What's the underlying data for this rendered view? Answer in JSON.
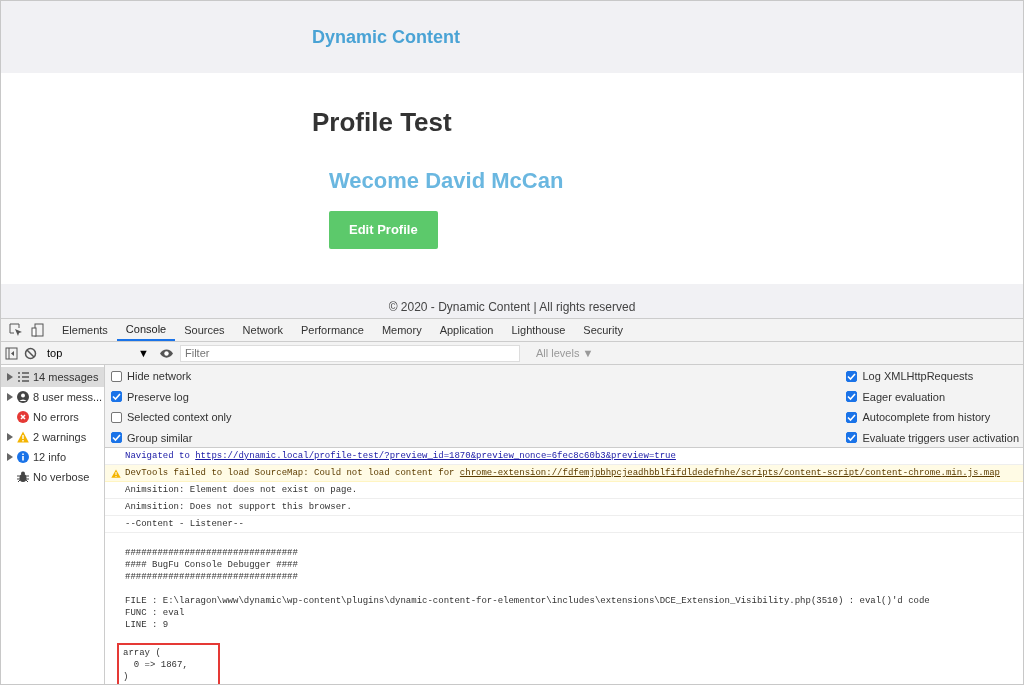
{
  "site": {
    "brand": "Dynamic Content",
    "page_title": "Profile Test",
    "greeting": "Wecome David McCan",
    "edit_button": "Edit Profile",
    "footer": "© 2020 - Dynamic Content | All rights reserved"
  },
  "devtools": {
    "tabs": [
      {
        "label": "Elements",
        "selected": false
      },
      {
        "label": "Console",
        "selected": true
      },
      {
        "label": "Sources",
        "selected": false
      },
      {
        "label": "Network",
        "selected": false
      },
      {
        "label": "Performance",
        "selected": false
      },
      {
        "label": "Memory",
        "selected": false
      },
      {
        "label": "Application",
        "selected": false
      },
      {
        "label": "Lighthouse",
        "selected": false
      },
      {
        "label": "Security",
        "selected": false
      }
    ],
    "toolbar": {
      "context": "top",
      "context_caret": "▼",
      "filter_placeholder": "Filter",
      "levels": "All levels ▼"
    },
    "sidebar": [
      {
        "kind": "messages",
        "label": "14 messages",
        "expandable": true,
        "selected": true
      },
      {
        "kind": "user",
        "label": "8 user mess...",
        "expandable": true,
        "selected": false
      },
      {
        "kind": "errors",
        "label": "No errors",
        "expandable": false,
        "selected": false
      },
      {
        "kind": "warnings",
        "label": "2 warnings",
        "expandable": true,
        "selected": false
      },
      {
        "kind": "info",
        "label": "12 info",
        "expandable": true,
        "selected": false
      },
      {
        "kind": "verbose",
        "label": "No verbose",
        "expandable": false,
        "selected": false
      }
    ],
    "settings_left": [
      {
        "label": "Hide network",
        "checked": false
      },
      {
        "label": "Preserve log",
        "checked": true
      },
      {
        "label": "Selected context only",
        "checked": false
      },
      {
        "label": "Group similar",
        "checked": true
      }
    ],
    "settings_right": [
      {
        "label": "Log XMLHttpRequests",
        "checked": true
      },
      {
        "label": "Eager evaluation",
        "checked": true
      },
      {
        "label": "Autocomplete from history",
        "checked": true
      },
      {
        "label": "Evaluate triggers user activation",
        "checked": true
      }
    ],
    "messages": [
      {
        "kind": "navigation",
        "text": "Navigated to ",
        "link": "https://dynamic.local/profile-test/?preview_id=1870&preview_nonce=6fec8c60b3&preview=true"
      },
      {
        "kind": "warning",
        "text": "DevTools failed to load SourceMap: Could not load content for ",
        "link": "chrome-extension://fdfemjpbhpcjeadhbblfifdldedefnhe/scripts/content-script/content-chrome.min.js.map"
      },
      {
        "kind": "log",
        "text": "Animsition: Element does not exist on page."
      },
      {
        "kind": "log",
        "text": "Animsition: Does not support this browser."
      },
      {
        "kind": "log",
        "text": "--Content - Listener--"
      },
      {
        "kind": "block",
        "blocks": [
          {
            "text": "\n################################\n#### BugFu Console Debugger ####\n################################\n\nFILE : E:\\laragon\\www\\dynamic\\wp-content\\plugins\\dynamic-content-for-elementor\\includes\\extensions\\DCE_Extension_Visibility.php(3510) : eval()'d code\nFUNC : eval\nLINE : 9\n",
            "highlighted": false
          },
          {
            "text": "array (\n  0 => 1867,\n)",
            "highlighted": true
          }
        ]
      }
    ]
  }
}
